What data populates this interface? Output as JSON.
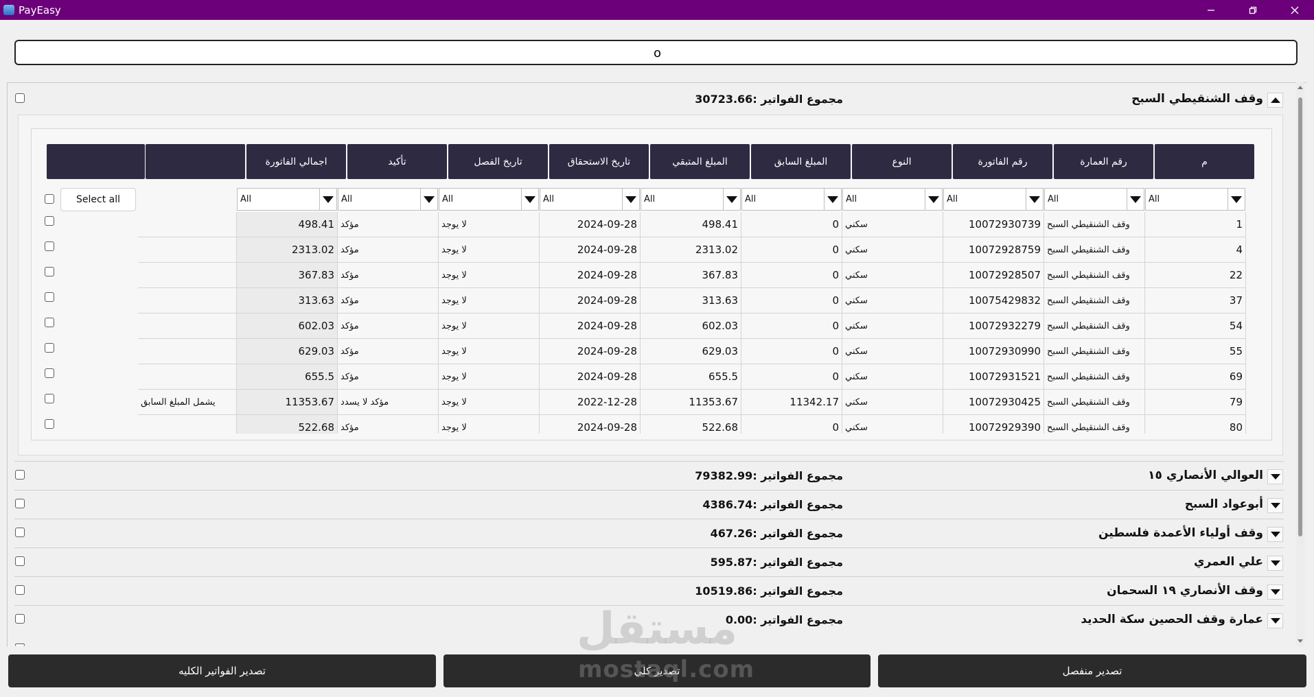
{
  "app": {
    "title": "PayEasy"
  },
  "search": {
    "value": "o"
  },
  "columns": [
    "م",
    "رقم العمارة",
    "رقم الفاتورة",
    "النوع",
    "المبلغ السابق",
    "المبلغ المتبقي",
    "تاريخ الاستحقاق",
    "تاريخ الفصل",
    "تأكيد",
    "اجمالي الفاتورة",
    "",
    ""
  ],
  "filter_value": "All",
  "select_all_label": "Select all",
  "groups": [
    {
      "name": "وقف الشنقيطي السبح",
      "total_label": "مجموع الفواتير :30723.66",
      "expanded": true
    },
    {
      "name": "العوالي الأنصاري ١٥",
      "total_label": "مجموع الفواتير :79382.99",
      "expanded": false
    },
    {
      "name": "أبوعواد السبح",
      "total_label": "مجموع الفواتير :4386.74",
      "expanded": false
    },
    {
      "name": "وقف أولياء الأعمدة  فلسطين",
      "total_label": "مجموع الفواتير :467.26",
      "expanded": false
    },
    {
      "name": "علي العمري",
      "total_label": "مجموع الفواتير :595.87",
      "expanded": false
    },
    {
      "name": "وقف الأنصاري ١٩ السحمان",
      "total_label": "مجموع الفواتير :10519.86",
      "expanded": false
    },
    {
      "name": "عمارة وقف الحصين سكة الحديد",
      "total_label": "مجموع الفواتير :0.00",
      "expanded": false
    }
  ],
  "rows": [
    {
      "m": "1",
      "building": "وقف الشنقيطي السبح",
      "invoice": "10072930739",
      "type": "سكني",
      "prev": "0",
      "remaining": "498.41",
      "due": "2024-09-28",
      "cut": "لا يوجد",
      "confirm": "مؤكد",
      "total": "498.41",
      "note": ""
    },
    {
      "m": "4",
      "building": "وقف الشنقيطي السبح",
      "invoice": "10072928759",
      "type": "سكني",
      "prev": "0",
      "remaining": "2313.02",
      "due": "2024-09-28",
      "cut": "لا يوجد",
      "confirm": "مؤكد",
      "total": "2313.02",
      "note": ""
    },
    {
      "m": "22",
      "building": "وقف الشنقيطي السبح",
      "invoice": "10072928507",
      "type": "سكني",
      "prev": "0",
      "remaining": "367.83",
      "due": "2024-09-28",
      "cut": "لا يوجد",
      "confirm": "مؤكد",
      "total": "367.83",
      "note": ""
    },
    {
      "m": "37",
      "building": "وقف الشنقيطي السبح",
      "invoice": "10075429832",
      "type": "سكني",
      "prev": "0",
      "remaining": "313.63",
      "due": "2024-09-28",
      "cut": "لا يوجد",
      "confirm": "مؤكد",
      "total": "313.63",
      "note": ""
    },
    {
      "m": "54",
      "building": "وقف الشنقيطي السبح",
      "invoice": "10072932279",
      "type": "سكني",
      "prev": "0",
      "remaining": "602.03",
      "due": "2024-09-28",
      "cut": "لا يوجد",
      "confirm": "مؤكد",
      "total": "602.03",
      "note": ""
    },
    {
      "m": "55",
      "building": "وقف الشنقيطي السبح",
      "invoice": "10072930990",
      "type": "سكني",
      "prev": "0",
      "remaining": "629.03",
      "due": "2024-09-28",
      "cut": "لا يوجد",
      "confirm": "مؤكد",
      "total": "629.03",
      "note": ""
    },
    {
      "m": "69",
      "building": "وقف الشنقيطي السبح",
      "invoice": "10072931521",
      "type": "سكني",
      "prev": "0",
      "remaining": "655.5",
      "due": "2024-09-28",
      "cut": "لا يوجد",
      "confirm": "مؤكد",
      "total": "655.5",
      "note": ""
    },
    {
      "m": "79",
      "building": "وقف الشنقيطي السبح",
      "invoice": "10072930425",
      "type": "سكني",
      "prev": "11342.17",
      "remaining": "11353.67",
      "due": "2022-12-28",
      "cut": "لا يوجد",
      "confirm": "مؤكد لا يسدد",
      "total": "11353.67",
      "note": "يشمل المبلغ السابق"
    },
    {
      "m": "80",
      "building": "وقف الشنقيطي السبح",
      "invoice": "10072929390",
      "type": "سكني",
      "prev": "0",
      "remaining": "522.68",
      "due": "2024-09-28",
      "cut": "لا يوجد",
      "confirm": "مؤكد",
      "total": "522.68",
      "note": ""
    }
  ],
  "buttons": {
    "export_separate": "تصدير منفصل",
    "export_all": "تصدير كلي",
    "export_all_invoices": "تصدير الفواتير الكليه"
  },
  "watermark": {
    "arabic": "مستقل",
    "latin": "mostaql.com"
  },
  "colors": {
    "titlebar": "#6c007a",
    "header_button": "#2e2a42",
    "bottom_button": "#2b2b2b"
  }
}
